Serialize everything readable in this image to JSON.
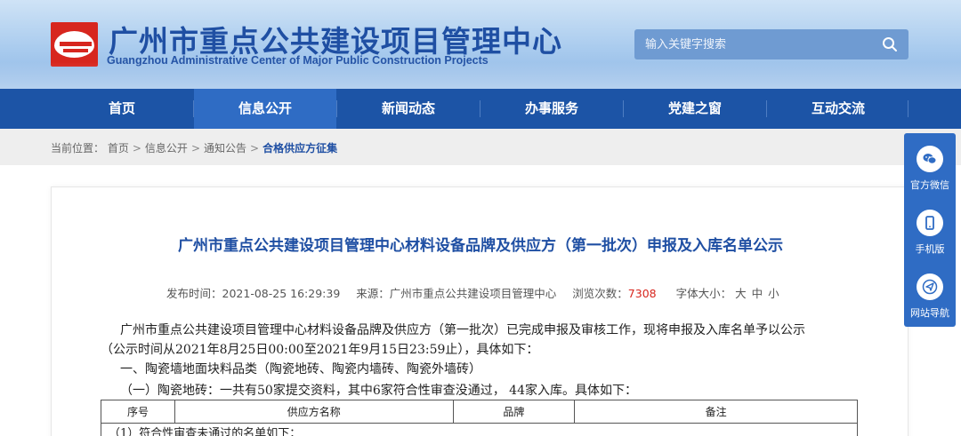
{
  "header": {
    "title_cn": "广州市重点公共建设项目管理中心",
    "title_en": "Guangzhou Administrative Center of Major Public Construction Projects",
    "search_placeholder": "输入关键字搜索",
    "search_icon": "search-icon"
  },
  "nav": [
    {
      "label": "首页"
    },
    {
      "label": "信息公开"
    },
    {
      "label": "新闻动态"
    },
    {
      "label": "办事服务"
    },
    {
      "label": "党建之窗"
    },
    {
      "label": "互动交流"
    }
  ],
  "breadcrumb": {
    "prefix": "当前位置：",
    "items": [
      "首页",
      "信息公开",
      "通知公告",
      "合格供应方征集"
    ],
    "separator": ">"
  },
  "article": {
    "title": "广州市重点公共建设项目管理中心材料设备品牌及供应方（第一批次）申报及入库名单公示",
    "publish_label": "发布时间：",
    "publish_time": "2021-08-25 16:29:39",
    "source_label": "来源：",
    "source": "广州市重点公共建设项目管理中心",
    "views_label": "浏览次数：",
    "views": "7308",
    "fontsize_label": "字体大小：",
    "fontsize_large": "大",
    "fontsize_medium": "中",
    "fontsize_small": "小",
    "para1": "广州市重点公共建设项目管理中心材料设备品牌及供应方（第一批次）已完成申报及审核工作，现将申报及入库名单予以公示",
    "para2": "（公示时间从2021年8月25日00:00至2021年9月15日23:59止），具体如下：",
    "para3": "一、陶瓷墙地面块料品类（陶瓷地砖、陶瓷内墙砖、陶瓷外墙砖）",
    "para4": "（一）陶瓷地砖：一共有50家提交资料，其中6家符合性审查没通过， 44家入库。具体如下：",
    "table_headers": [
      "序号",
      "供应方名称",
      "品牌",
      "备注"
    ],
    "table_row1": "（1）符合性审查未通过的名单如下："
  },
  "sidebar": [
    {
      "label": "官方微信",
      "icon": "wechat-icon"
    },
    {
      "label": "手机版",
      "icon": "mobile-icon"
    },
    {
      "label": "网站导航",
      "icon": "navigation-icon"
    }
  ],
  "colors": {
    "brand_blue": "#1c54a6",
    "accent_red": "#d7261e"
  }
}
